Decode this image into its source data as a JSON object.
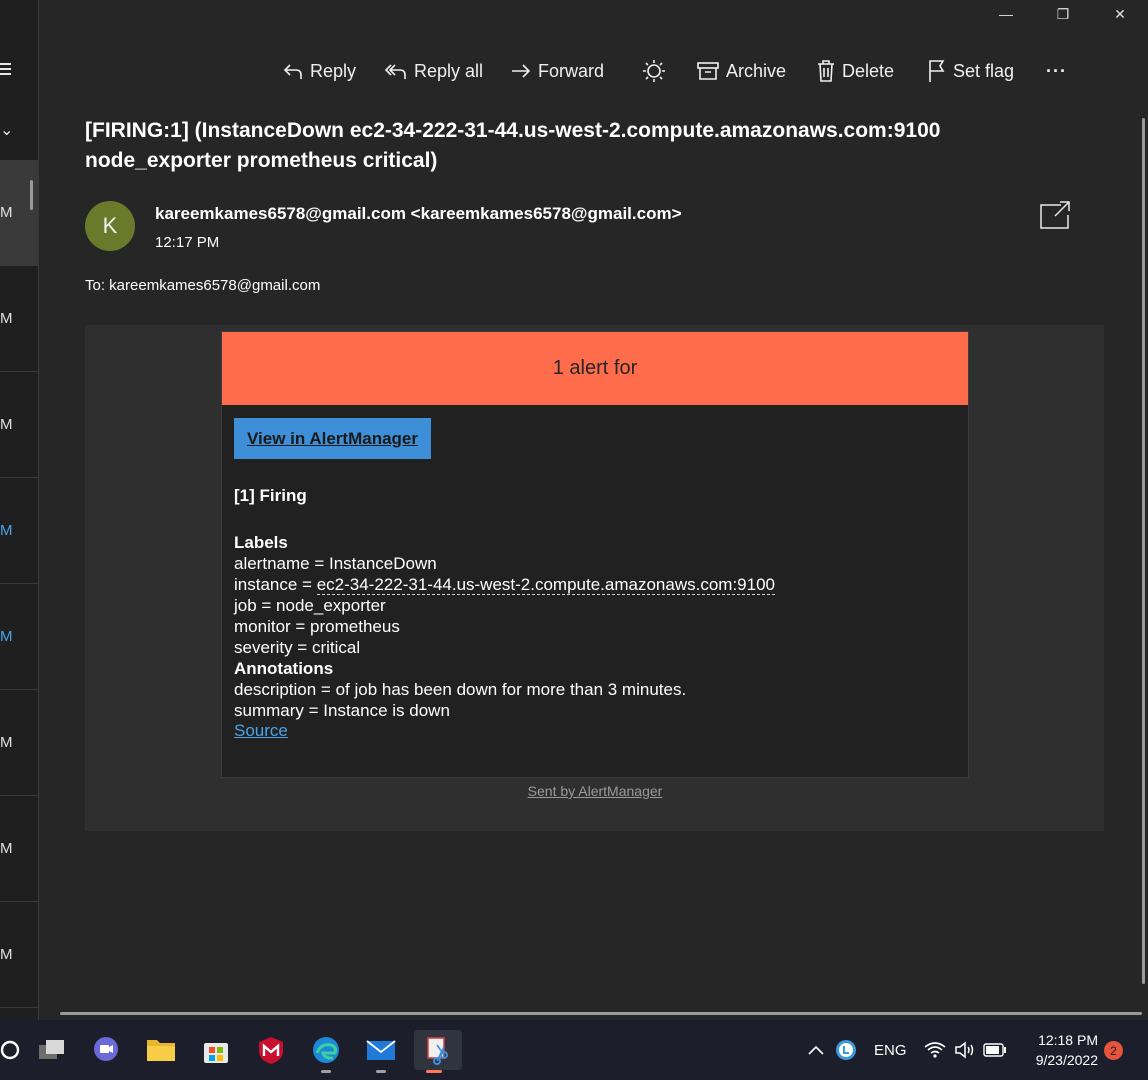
{
  "window": {
    "minimize": "—",
    "restore": "❐",
    "close": "✕"
  },
  "left_list": {
    "times": [
      "M",
      "M",
      "M",
      "M",
      "M",
      "M",
      "M",
      "M"
    ]
  },
  "toolbar": {
    "reply": "Reply",
    "reply_all": "Reply all",
    "forward": "Forward",
    "archive": "Archive",
    "delete": "Delete",
    "set_flag": "Set flag",
    "more": "···"
  },
  "email": {
    "subject": "[FIRING:1]  (InstanceDown ec2-34-222-31-44.us-west-2.compute.amazonaws.com:9100 node_exporter prometheus critical)",
    "avatar_initial": "K",
    "sender": "kareemkames6578@gmail.com <kareemkames6578@gmail.com>",
    "time": "12:17 PM",
    "to": "To: kareemkames6578@gmail.com"
  },
  "alert": {
    "header": "1 alert for",
    "view_button": "View in AlertManager",
    "firing": "[1] Firing",
    "labels_heading": "Labels",
    "alertname": "alertname = InstanceDown",
    "instance_prefix": "instance = ",
    "instance_value": "ec2-34-222-31-44.us-west-2.compute.amazonaws.com:9100",
    "job": "job = node_exporter",
    "monitor": "monitor = prometheus",
    "severity": "severity = critical",
    "annotations_heading": "Annotations",
    "description": "description = of job has been down for more than 3 minutes.",
    "summary": "summary = Instance is down",
    "source": "Source",
    "sent_by": "Sent by AlertManager"
  },
  "taskbar": {
    "language": "ENG",
    "clock_time": "12:18 PM",
    "clock_date": "9/23/2022",
    "notification_count": "2"
  },
  "colors": {
    "alert_header": "#ff6c4c",
    "button_blue": "#3d8fd8",
    "avatar": "#6b7a2a"
  }
}
